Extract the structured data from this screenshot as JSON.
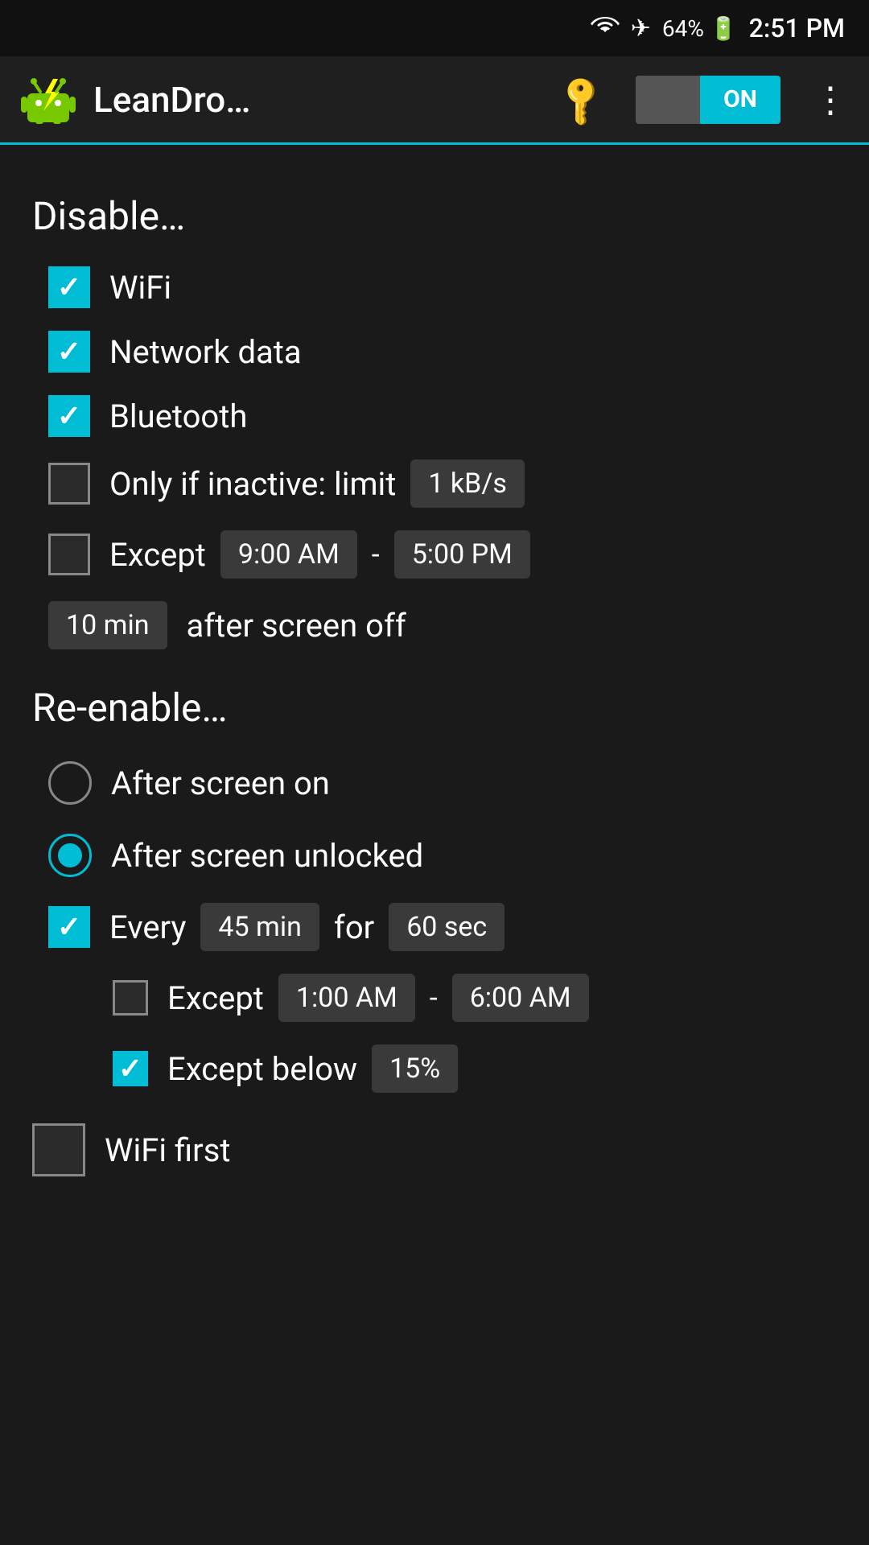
{
  "statusBar": {
    "battery": "64%",
    "time": "2:51 PM"
  },
  "topBar": {
    "appTitle": "LeanDro…",
    "toggleLabel": "ON",
    "moreIcon": "⋮"
  },
  "disable": {
    "sectionTitle": "Disable…",
    "wifi": {
      "label": "WiFi",
      "checked": true
    },
    "networkData": {
      "label": "Network data",
      "checked": true
    },
    "bluetooth": {
      "label": "Bluetooth",
      "checked": true
    },
    "onlyIfInactive": {
      "label": "Only if inactive: limit",
      "checked": false,
      "value": "1 kB/s"
    },
    "except": {
      "label": "Except",
      "checked": false,
      "from": "9:00 AM",
      "to": "5:00 PM"
    },
    "afterScreenOff": {
      "delay": "10 min",
      "label": "after screen off"
    }
  },
  "reenable": {
    "sectionTitle": "Re-enable…",
    "afterScreenOn": {
      "label": "After screen on",
      "selected": false
    },
    "afterScreenUnlocked": {
      "label": "After screen unlocked",
      "selected": true
    },
    "every": {
      "label": "Every",
      "checked": true,
      "interval": "45 min",
      "forLabel": "for",
      "duration": "60 sec"
    },
    "exceptTime": {
      "label": "Except",
      "checked": false,
      "from": "1:00 AM",
      "dash": "-",
      "to": "6:00 AM"
    },
    "exceptBelow": {
      "label": "Except below",
      "checked": true,
      "value": "15%"
    }
  },
  "wifiFirst": {
    "label": "WiFi first",
    "checked": false
  }
}
